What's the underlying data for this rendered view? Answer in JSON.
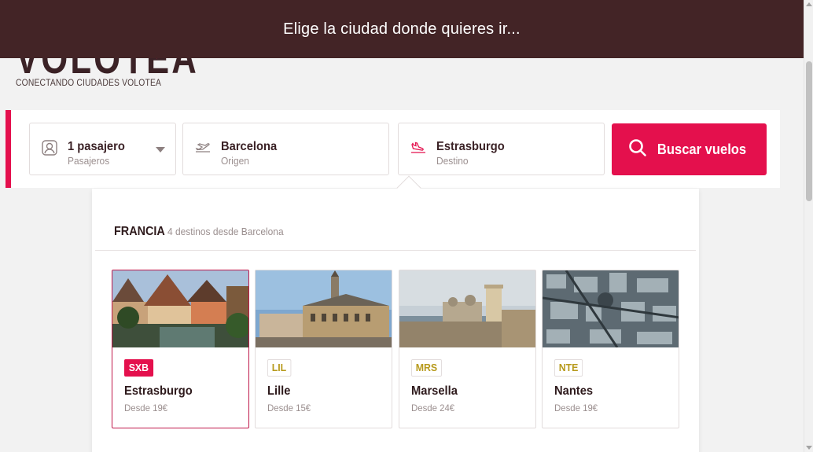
{
  "banner": {
    "text": "Elige la ciudad donde quieres ir..."
  },
  "brand": {
    "logo": "VOLOTEA",
    "tagline": "CONECTANDO CIUDADES VOLOTEA",
    "accent": "#e4104d",
    "dark": "#432426"
  },
  "search": {
    "passengers": {
      "value": "1 pasajero",
      "label": "Pasajeros",
      "icon": "user-icon"
    },
    "origin": {
      "value": "Barcelona",
      "label": "Origen",
      "icon": "takeoff-icon"
    },
    "destination": {
      "value": "Estrasburgo",
      "label": "Destino",
      "icon": "landing-icon"
    },
    "button_label": "Buscar vuelos"
  },
  "destinations": {
    "country": "FRANCIA",
    "subtitle": "4 destinos desde Barcelona",
    "cards": [
      {
        "code": "SXB",
        "city": "Estrasburgo",
        "price": "Desde 19€",
        "selected": true
      },
      {
        "code": "LIL",
        "city": "Lille",
        "price": "Desde 15€",
        "selected": false
      },
      {
        "code": "MRS",
        "city": "Marsella",
        "price": "Desde 24€",
        "selected": false
      },
      {
        "code": "NTE",
        "city": "Nantes",
        "price": "Desde 19€",
        "selected": false
      }
    ]
  }
}
